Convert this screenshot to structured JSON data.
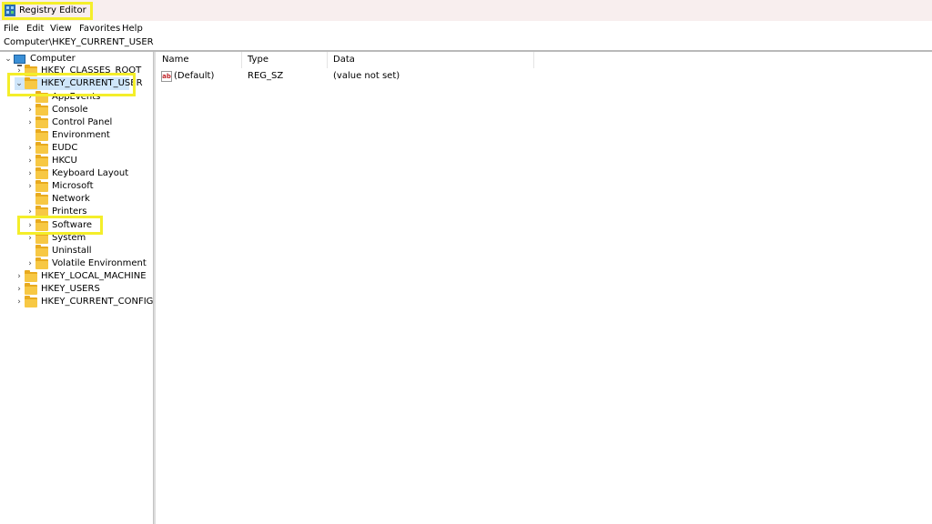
{
  "window": {
    "title": "Registry Editor",
    "icon": "registry-editor-icon"
  },
  "menu": {
    "items": [
      "File",
      "Edit",
      "View",
      "Favorites",
      "Help"
    ]
  },
  "address": {
    "path": "Computer\\HKEY_CURRENT_USER"
  },
  "tree": {
    "root": "Computer",
    "nodes": [
      "HKEY_CLASSES_ROOT",
      "HKEY_CURRENT_USER",
      "AppEvents",
      "Console",
      "Control Panel",
      "Environment",
      "EUDC",
      "HKCU",
      "Keyboard Layout",
      "Microsoft",
      "Network",
      "Printers",
      "Software",
      "System",
      "Uninstall",
      "Volatile Environment",
      "HKEY_LOCAL_MACHINE",
      "HKEY_USERS",
      "HKEY_CURRENT_CONFIG"
    ],
    "selected": "HKEY_CURRENT_USER"
  },
  "list": {
    "columns": [
      "Name",
      "Type",
      "Data"
    ],
    "rows": [
      {
        "name": "(Default)",
        "type": "REG_SZ",
        "data": "(value not set)"
      }
    ]
  },
  "colors": {
    "highlight": "#f4ee2a",
    "selection": "#cfe6fa",
    "folder": "#f7c844",
    "titlebar": "#f8eeee"
  }
}
